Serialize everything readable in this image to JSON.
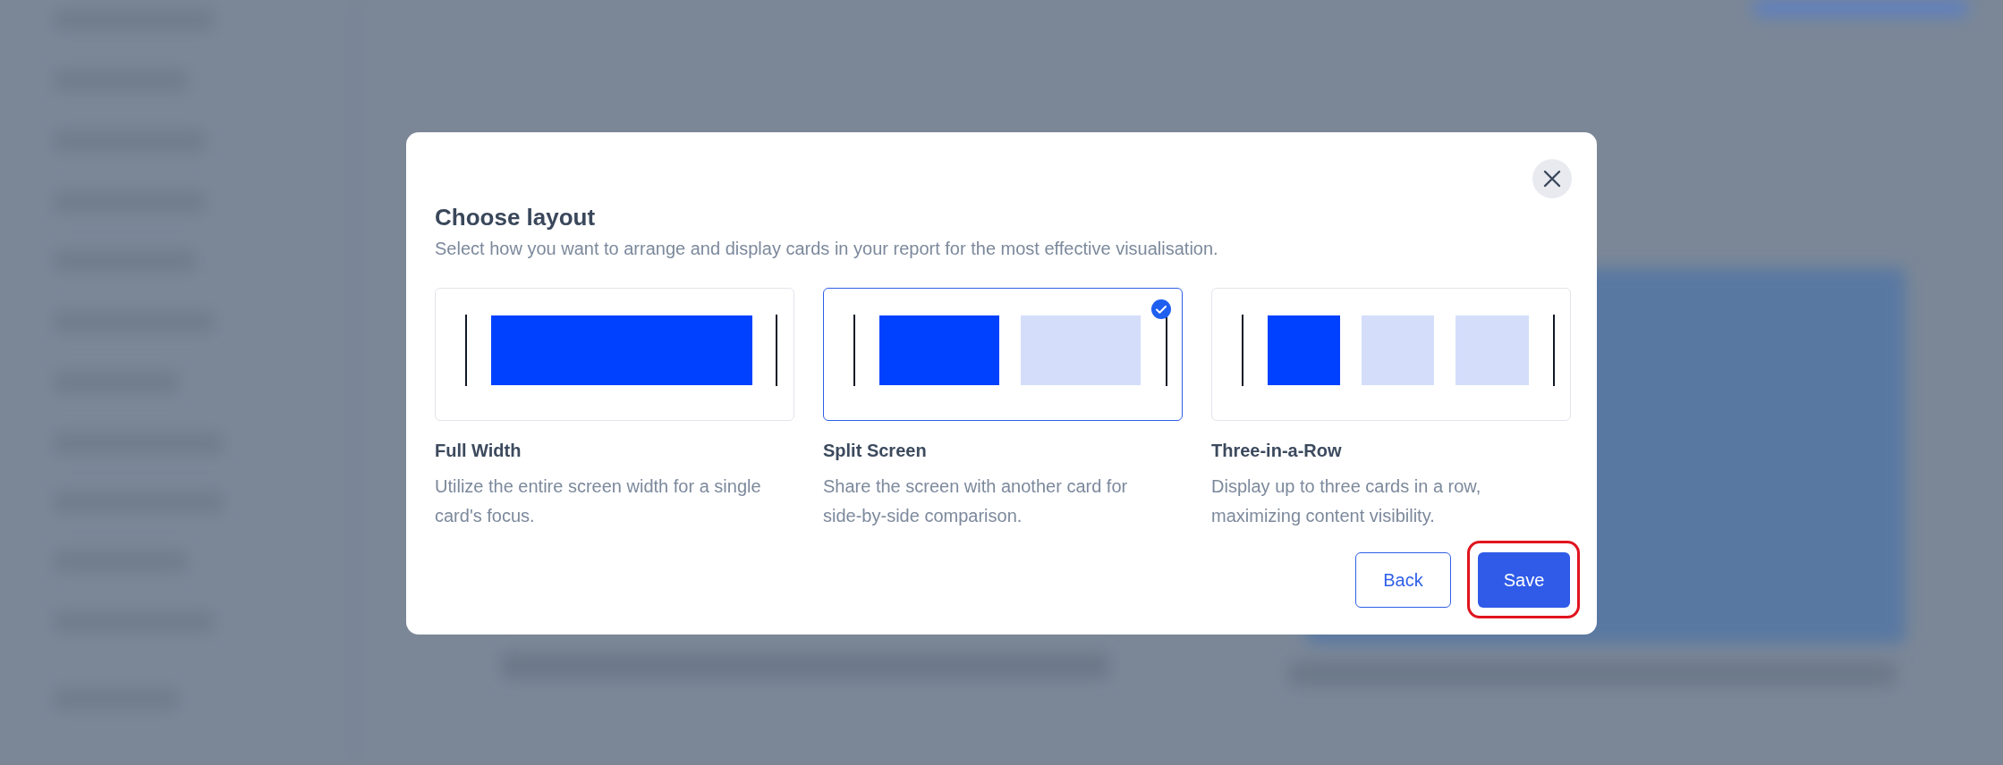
{
  "dialog": {
    "title": "Choose layout",
    "subtitle": "Select how you want to arrange and display cards in your report for the most effective visualisation.",
    "options": [
      {
        "kind": "full",
        "title": "Full Width",
        "description": "Utilize the entire screen width for a single card's focus.",
        "selected": false
      },
      {
        "kind": "split",
        "title": "Split Screen",
        "description": "Share the screen with another card for side-by-side comparison.",
        "selected": true
      },
      {
        "kind": "three",
        "title": "Three-in-a-Row",
        "description": "Display up to three cards in a row, maximizing content visibility.",
        "selected": false
      }
    ],
    "buttons": [
      {
        "kind": "secondary",
        "label": "Back",
        "highlighted": false
      },
      {
        "kind": "primary",
        "label": "Save",
        "highlighted": true
      }
    ]
  }
}
